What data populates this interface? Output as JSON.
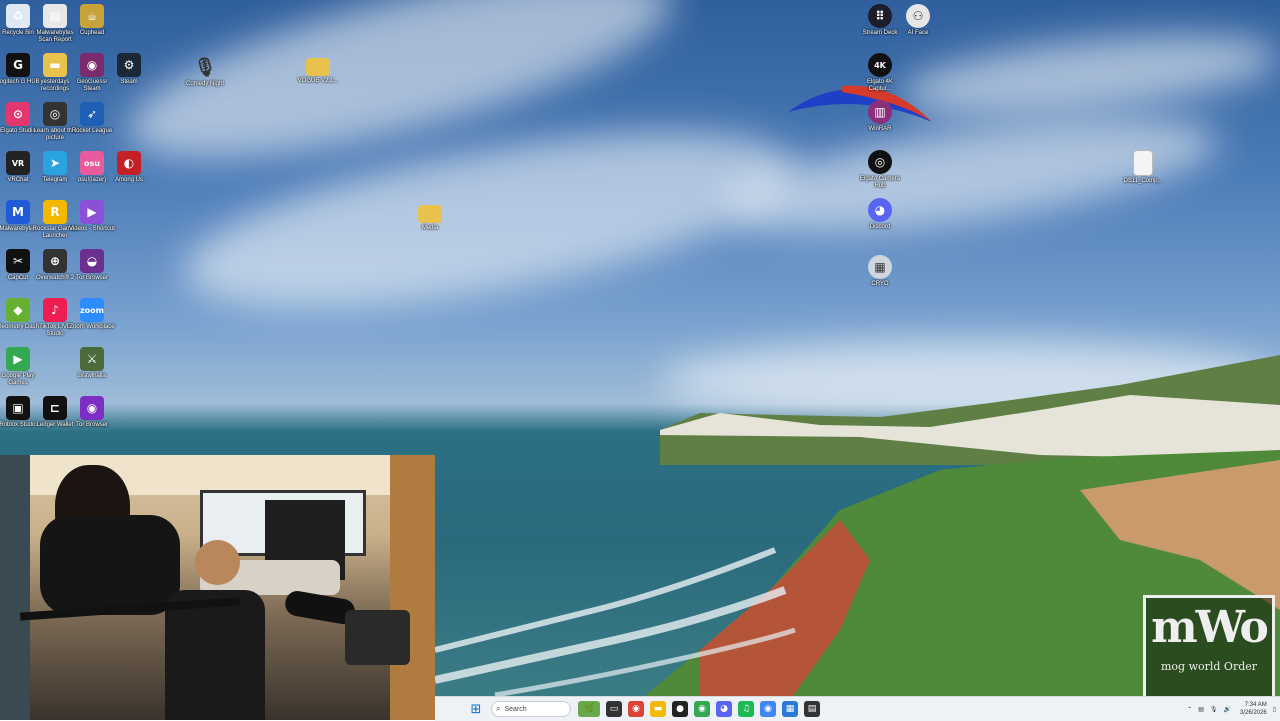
{
  "desktop_icons_left": [
    {
      "label": "Recycle Bin",
      "icon": "recycle-bin-icon",
      "color": "#dfe8f3",
      "glyph": "♻"
    },
    {
      "label": "Malwarebytes Scan Report",
      "icon": "document-icon",
      "color": "#e8e8e8",
      "glyph": "▤"
    },
    {
      "label": "Cuphead",
      "icon": "cuphead-icon",
      "color": "#c8a23a",
      "glyph": "☕"
    },
    {
      "label": "Logitech G HUB",
      "icon": "logitech-g-icon",
      "color": "#111111",
      "glyph": "G"
    },
    {
      "label": "yesterdays recordings",
      "icon": "folder-icon",
      "color": "#e8c24d",
      "glyph": "▬"
    },
    {
      "label": "GeoGuessr Steam",
      "icon": "geoguessr-icon",
      "color": "#7b2a6c",
      "glyph": "◉"
    },
    {
      "label": "Steam",
      "icon": "steam-icon",
      "color": "#1b2838",
      "glyph": "⚙"
    },
    {
      "label": "Elgato Studio",
      "icon": "elgato-studio-icon",
      "color": "#e2376f",
      "glyph": "⊙"
    },
    {
      "label": "Learn about this picture",
      "icon": "camera-icon",
      "color": "#333333",
      "glyph": "◎"
    },
    {
      "label": "Rocket League",
      "icon": "rocket-league-icon",
      "color": "#1f5fb5",
      "glyph": "➶"
    },
    {
      "label": "VRChat",
      "icon": "vrchat-icon",
      "color": "#222222",
      "glyph": "VR"
    },
    {
      "label": "Telegram",
      "icon": "telegram-icon",
      "color": "#2aa3df",
      "glyph": "➤"
    },
    {
      "label": "osu!(lazer)",
      "icon": "osu-icon",
      "color": "#e85a9c",
      "glyph": "osu"
    },
    {
      "label": "Among Us",
      "icon": "among-us-icon",
      "color": "#c52026",
      "glyph": "◐"
    },
    {
      "label": "Malwarebytes",
      "icon": "malwarebytes-icon",
      "color": "#1f5bd9",
      "glyph": "M"
    },
    {
      "label": "Rockstar Games Launcher",
      "icon": "rockstar-icon",
      "color": "#f5b800",
      "glyph": "R"
    },
    {
      "label": "Videos - Shortcut",
      "icon": "videos-icon",
      "color": "#8b4fd8",
      "glyph": "▶"
    },
    {
      "label": "CapCut",
      "icon": "capcut-icon",
      "color": "#111111",
      "glyph": "✂"
    },
    {
      "label": "Overwatch® 2",
      "icon": "overwatch-icon",
      "color": "#333333",
      "glyph": "⊕"
    },
    {
      "label": "Tor Browser",
      "icon": "tor-browser-icon",
      "color": "#6b2f8f",
      "glyph": "◒"
    },
    {
      "label": "Geometry Dash",
      "icon": "geometry-dash-icon",
      "color": "#66b032",
      "glyph": "◆"
    },
    {
      "label": "TikTok LIVE Studio",
      "icon": "tiktok-icon",
      "color": "#ee1d52",
      "glyph": "♪"
    },
    {
      "label": "Zoom Workplace",
      "icon": "zoom-icon",
      "color": "#2d8cff",
      "glyph": "zoom"
    },
    {
      "label": "Google Play Games",
      "icon": "google-play-games-icon",
      "color": "#34a853",
      "glyph": "▶"
    },
    {
      "label": "Brawlhalla",
      "icon": "brawlhalla-icon",
      "color": "#4b6b3a",
      "glyph": "⚔"
    },
    {
      "label": "Roblox Studio",
      "icon": "roblox-studio-icon",
      "color": "#111111",
      "glyph": "▣"
    },
    {
      "label": "Ledger Wallet",
      "icon": "ledger-wallet-icon",
      "color": "#111111",
      "glyph": "⊏"
    },
    {
      "label": "Tor Browser",
      "icon": "tor-browser-icon",
      "color": "#7d2fc4",
      "glyph": "◉"
    }
  ],
  "desktop_icons_misc": [
    {
      "label": "Comedy Night",
      "icon": "microphone-icon"
    },
    {
      "label": "VOGUE V2.1...",
      "icon": "folder-icon"
    },
    {
      "label": "Media",
      "icon": "folder-icon"
    },
    {
      "label": "DS11_Comp...",
      "icon": "document-icon"
    }
  ],
  "desktop_icons_right": [
    {
      "label": "Stream Deck",
      "icon": "stream-deck-icon",
      "color": "#1d1d2b",
      "glyph": "⠿"
    },
    {
      "label": "AI Face",
      "icon": "ai-face-icon",
      "color": "#e6e6e6",
      "glyph": "⚇"
    },
    {
      "label": "Elgato 4K Captur...",
      "icon": "elgato-4k-icon",
      "color": "#111111",
      "glyph": "4K"
    },
    {
      "label": "WinRAR",
      "icon": "winrar-icon",
      "color": "#8b2f7c",
      "glyph": "▥"
    },
    {
      "label": "Elgato Camera Hub",
      "icon": "elgato-camera-icon",
      "color": "#111111",
      "glyph": "◎"
    },
    {
      "label": "Discord",
      "icon": "discord-icon",
      "color": "#5865f2",
      "glyph": "◕"
    },
    {
      "label": "CRYO",
      "icon": "cryo-icon",
      "color": "#cfd6dc",
      "glyph": "▦"
    }
  ],
  "watermark": {
    "big": "mWo",
    "small": "mog world Order"
  },
  "taskbar": {
    "search_placeholder": "Search",
    "apps": [
      {
        "icon": "start-icon",
        "color": "#0a6ed1",
        "glyph": "⊞"
      },
      {
        "icon": "task-view-icon",
        "color": "#333333",
        "glyph": "▭"
      },
      {
        "icon": "chrome-icon",
        "color": "#db4437",
        "glyph": "◉"
      },
      {
        "icon": "file-explorer-icon",
        "color": "#f2b90c",
        "glyph": "▬"
      },
      {
        "icon": "obs-icon",
        "color": "#222222",
        "glyph": "●"
      },
      {
        "icon": "chrome-profile-icon",
        "color": "#34a853",
        "glyph": "◉"
      },
      {
        "icon": "discord-taskbar-icon",
        "color": "#5865f2",
        "glyph": "◕"
      },
      {
        "icon": "spotify-icon",
        "color": "#1db954",
        "glyph": "♫"
      },
      {
        "icon": "chrome-alt-icon",
        "color": "#4285f4",
        "glyph": "◉"
      },
      {
        "icon": "calculator-icon",
        "color": "#2b7bd6",
        "glyph": "▦"
      },
      {
        "icon": "sticky-notes-icon",
        "color": "#333333",
        "glyph": "▤"
      }
    ],
    "time": "7:34 AM",
    "date": "3/26/2026"
  }
}
